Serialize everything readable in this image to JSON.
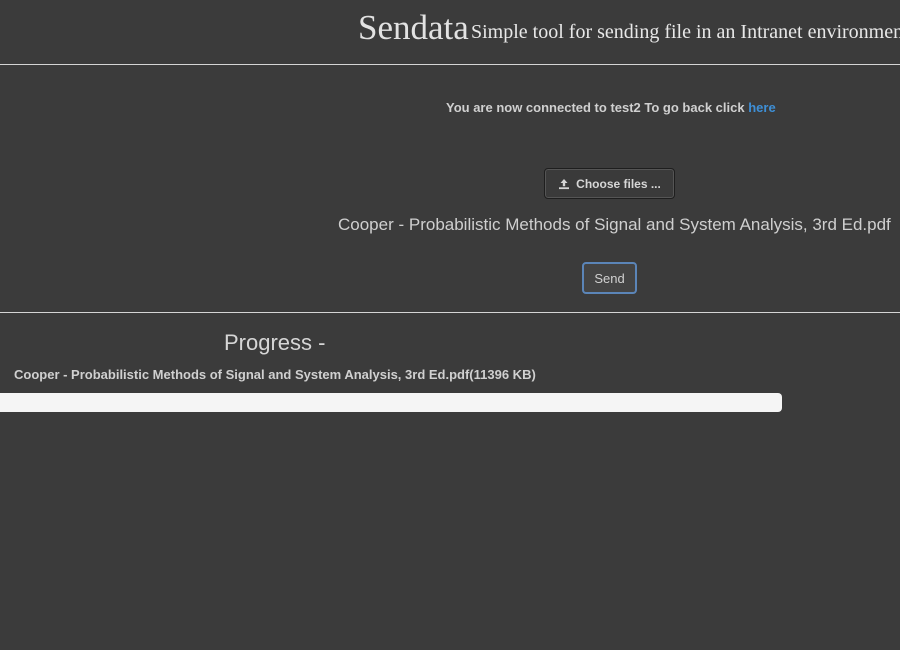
{
  "header": {
    "title": "Sendata",
    "subtitle": "Simple tool for sending file in an Intranet environment"
  },
  "connection": {
    "message": "You are now connected to test2 To go back click",
    "link_label": "here"
  },
  "upload": {
    "choose_label": "Choose files ...",
    "choose_icon": "upload-icon",
    "selected_file": "Cooper - Probabilistic Methods of Signal and System Analysis, 3rd Ed.pdf",
    "send_label": "Send"
  },
  "progress": {
    "title": "Progress -",
    "file_label": "Cooper - Probabilistic Methods of Signal and System Analysis, 3rd Ed.pdf(11396 KB)",
    "percent": 0
  },
  "colors": {
    "background": "#3b3b3b",
    "link": "#3e8fd6",
    "send_border": "#5b85b8",
    "progress_track": "#f5f5f5",
    "progress_fill": "#337ab7"
  }
}
